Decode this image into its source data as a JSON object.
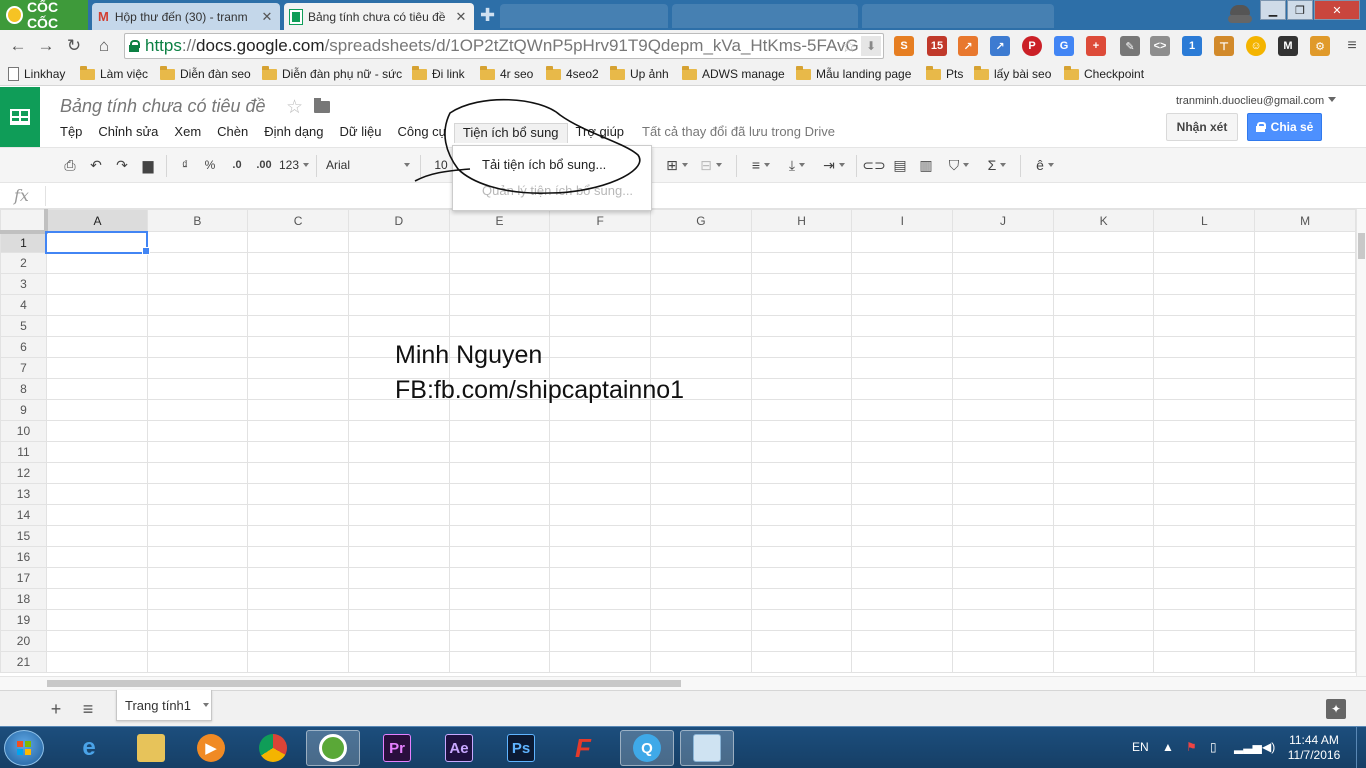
{
  "browser": {
    "brand": "CỐC CỐC",
    "tabs": [
      {
        "label": "Hộp thư đến (30) - tranm",
        "active": false
      },
      {
        "label": "Bảng tính chưa có tiêu đề",
        "active": true
      }
    ],
    "url_scheme": "https",
    "url_host": "docs.google.com",
    "url_path": "/spreadsheets/d/1OP2tZtQWnP5pHrv91T9Qdepm_kVa_HtKms-5FAvG",
    "extension_badge": "15"
  },
  "bookmarks": [
    {
      "label": "Linkhay",
      "type": "page"
    },
    {
      "label": "Làm việc",
      "type": "folder"
    },
    {
      "label": "Diễn đàn seo",
      "type": "folder"
    },
    {
      "label": "Diễn đàn phụ nữ - sức",
      "type": "folder"
    },
    {
      "label": "Đi link",
      "type": "folder"
    },
    {
      "label": "4r seo",
      "type": "folder"
    },
    {
      "label": "4seo2",
      "type": "folder"
    },
    {
      "label": "Up ảnh",
      "type": "folder"
    },
    {
      "label": "ADWS manage",
      "type": "folder"
    },
    {
      "label": "Mẫu landing page",
      "type": "folder"
    },
    {
      "label": "Pts",
      "type": "folder"
    },
    {
      "label": "lấy bài seo",
      "type": "folder"
    },
    {
      "label": "Checkpoint",
      "type": "folder"
    }
  ],
  "doc": {
    "title": "Bảng tính chưa có tiêu đề",
    "menus": [
      "Tệp",
      "Chỉnh sửa",
      "Xem",
      "Chèn",
      "Định dạng",
      "Dữ liệu",
      "Công cụ",
      "Tiện ích bổ sung",
      "Trợ giúp"
    ],
    "save_status": "Tất cả thay đổi đã lưu trong Drive",
    "account": "tranminh.duoclieu@gmail.com",
    "comments_label": "Nhận xét",
    "share_label": "Chia sẻ"
  },
  "toolbar": {
    "currency": "₫",
    "percent": "%",
    "dec_decrease": ".0",
    "dec_increase": ".00",
    "number_format": "123",
    "font": "Arial",
    "font_size": "10"
  },
  "addons_menu": {
    "items": [
      {
        "label": "Tải tiện ích bổ sung...",
        "enabled": true
      },
      {
        "label": "Quản lý tiện ích bổ sung...",
        "enabled": false
      }
    ]
  },
  "sheet": {
    "columns": [
      "A",
      "B",
      "C",
      "D",
      "E",
      "F",
      "G",
      "H",
      "I",
      "J",
      "K",
      "L",
      "M"
    ],
    "rows": [
      "1",
      "2",
      "3",
      "4",
      "5",
      "6",
      "7",
      "8",
      "9",
      "10",
      "11",
      "12",
      "13",
      "14",
      "15",
      "16",
      "17",
      "18",
      "19",
      "20",
      "21"
    ],
    "active_cell": "A1",
    "tab_name": "Trang tính1"
  },
  "overlay": {
    "line1": "Minh Nguyen",
    "line2": "FB:fb.com/shipcaptainno1"
  },
  "taskbar": {
    "apps": [
      {
        "name": "internet-explorer",
        "label": "e"
      },
      {
        "name": "file-explorer",
        "label": ""
      },
      {
        "name": "media-player",
        "label": "▶"
      },
      {
        "name": "chrome",
        "label": ""
      },
      {
        "name": "coccoc",
        "label": ""
      },
      {
        "name": "premiere",
        "label": "Pr"
      },
      {
        "name": "after-effects",
        "label": "Ae"
      },
      {
        "name": "photoshop",
        "label": "Ps"
      },
      {
        "name": "filezilla",
        "label": "F"
      },
      {
        "name": "quicktime",
        "label": "Q"
      },
      {
        "name": "notepad",
        "label": ""
      }
    ],
    "language": "EN",
    "time": "11:44 AM",
    "date": "11/7/2016"
  },
  "colors": {
    "sheets_green": "#0f9d58",
    "share_blue": "#4d90fe",
    "tabstrip_blue": "#2d6fa8",
    "selection_blue": "#4285f4"
  }
}
